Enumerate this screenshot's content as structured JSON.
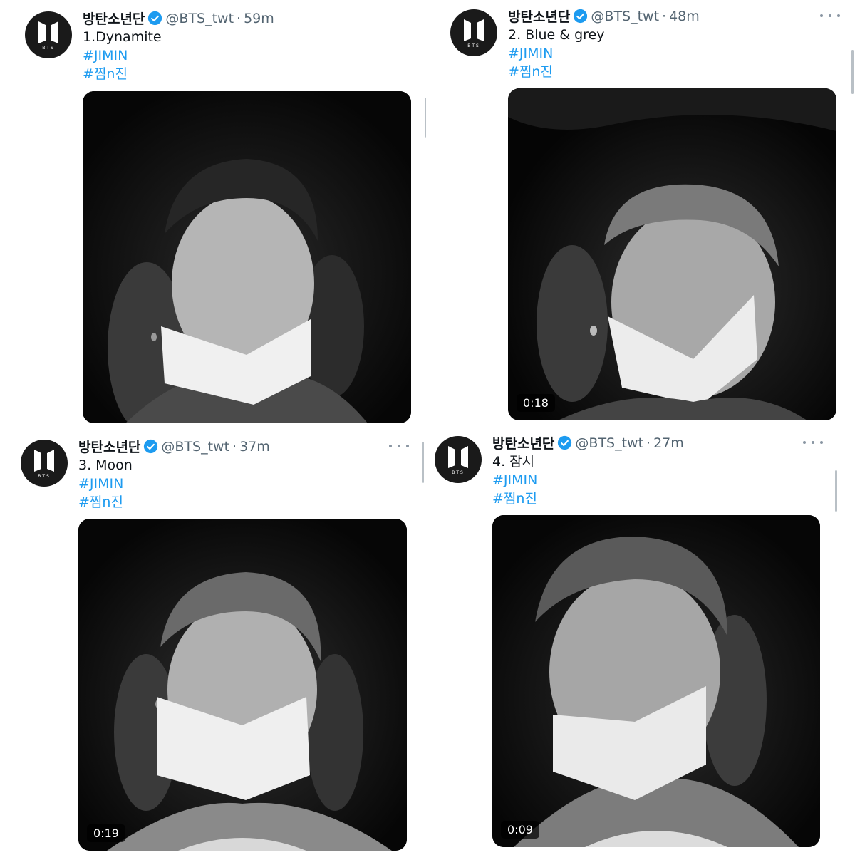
{
  "tweets": [
    {
      "name": "방탄소년단",
      "handle": "@BTS_twt",
      "time": "59m",
      "text": "1.Dynamite",
      "hashtags": [
        "#JIMIN",
        "#찜n진"
      ],
      "duration": ""
    },
    {
      "name": "방탄소년단",
      "handle": "@BTS_twt",
      "time": "48m",
      "text": "2. Blue & grey",
      "hashtags": [
        "#JIMIN",
        "#찜n진"
      ],
      "duration": "0:18"
    },
    {
      "name": "방탄소년단",
      "handle": "@BTS_twt",
      "time": "37m",
      "text": "3. Moon",
      "hashtags": [
        "#JIMIN",
        "#찜n진"
      ],
      "duration": "0:19"
    },
    {
      "name": "방탄소년단",
      "handle": "@BTS_twt",
      "time": "27m",
      "text": "4. 잠시",
      "hashtags": [
        "#JIMIN",
        "#찜n진"
      ],
      "duration": "0:09"
    }
  ],
  "avatar_label": "BTS",
  "separator": "·",
  "colors": {
    "hashtag": "#1d9bf0",
    "verified": "#1d9bf0",
    "muted": "#536471"
  },
  "icons": {
    "avatar": "bts-logo-icon",
    "verified": "verified-badge-icon",
    "more": "more-options-icon",
    "media": "video-thumbnail"
  }
}
